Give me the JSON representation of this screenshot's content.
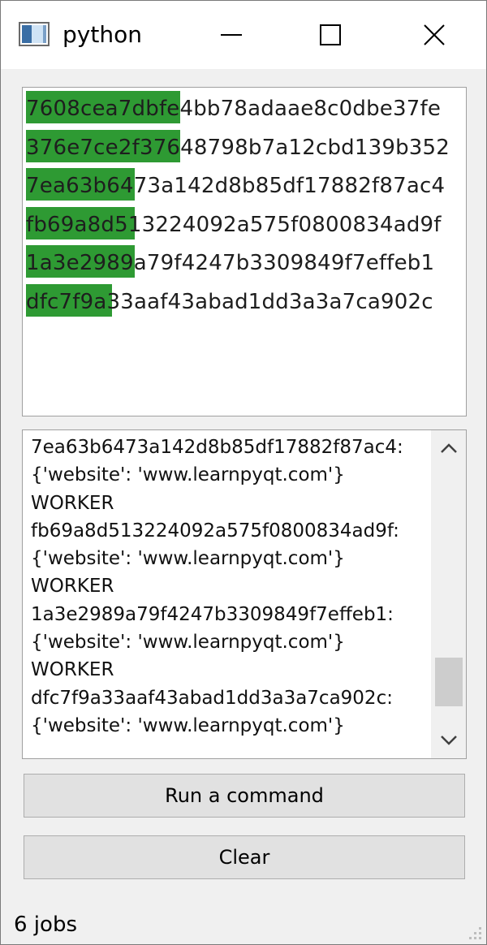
{
  "window": {
    "title": "python",
    "app_icon": "python-window-icon"
  },
  "titlebar_buttons": {
    "minimize_icon": "minimize-icon",
    "maximize_icon": "maximize-icon",
    "close_icon": "close-icon"
  },
  "jobs": [
    {
      "id": "7608cea7dbfe4bb78adaae8c0dbe37fe",
      "progress": 0.34
    },
    {
      "id": "376e7ce2f37648798b7a12cbd139b352",
      "progress": 0.34
    },
    {
      "id": "7ea63b6473a142d8b85df17882f87ac4",
      "progress": 0.24
    },
    {
      "id": "fb69a8d513224092a575f0800834ad9f",
      "progress": 0.24
    },
    {
      "id": "1a3e2989a79f4247b3309849f7effeb1",
      "progress": 0.24
    },
    {
      "id": "dfc7f9a33aaf43abad1dd3a3a7ca902c",
      "progress": 0.19
    }
  ],
  "log": {
    "lines": [
      "7ea63b6473a142d8b85df17882f87ac4:",
      "{'website': 'www.learnpyqt.com'}",
      "WORKER",
      "fb69a8d513224092a575f0800834ad9f:",
      "{'website': 'www.learnpyqt.com'}",
      "WORKER",
      "1a3e2989a79f4247b3309849f7effeb1:",
      "{'website': 'www.learnpyqt.com'}",
      "WORKER",
      "dfc7f9a33aaf43abad1dd3a3a7ca902c:",
      "{'website': 'www.learnpyqt.com'}"
    ],
    "scroll_position": 0.92
  },
  "buttons": {
    "run_label": "Run a command",
    "clear_label": "Clear"
  },
  "status": {
    "text": "6 jobs"
  },
  "colors": {
    "progress_fill": "#2e9a33",
    "window_bg": "#f0f0f0",
    "button_bg": "#e1e1e1"
  }
}
